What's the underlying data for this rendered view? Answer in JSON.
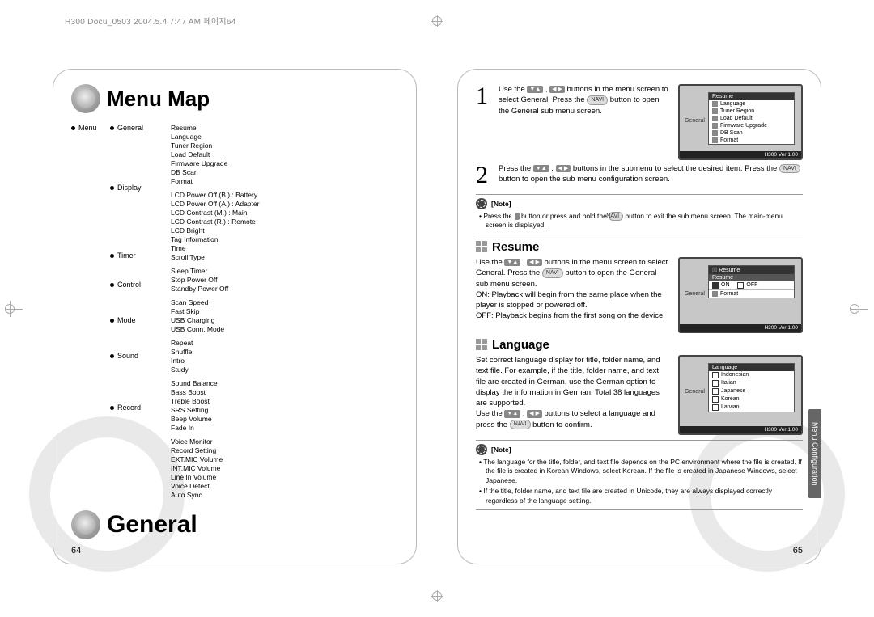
{
  "print_header": "H300 Docu_0503  2004.5.4 7:47 AM  페이지64",
  "titles": {
    "menu_map": "Menu Map",
    "general": "General"
  },
  "page_numbers": {
    "left": "64",
    "right": "65"
  },
  "menumap": {
    "root": "Menu",
    "categories": [
      {
        "name": "General",
        "items": [
          "Resume",
          "Language",
          "Tuner Region",
          "Load Default",
          "Firmware Upgrade",
          "DB Scan",
          "Format"
        ]
      },
      {
        "name": "Display",
        "items": [
          "LCD Power Off (B.) : Battery",
          "LCD Power Off (A.) : Adapter",
          "LCD Contrast (M.) : Main",
          "LCD Contrast (R.) : Remote",
          "LCD Bright",
          "Tag Information",
          "Time",
          "Scroll Type"
        ]
      },
      {
        "name": "Timer",
        "items": [
          "Sleep Timer",
          "Stop Power Off",
          "Standby Power Off"
        ]
      },
      {
        "name": "Control",
        "items": [
          "Scan Speed",
          "Fast Skip",
          "USB Charging",
          "USB Conn. Mode"
        ]
      },
      {
        "name": "Mode",
        "items": [
          "Repeat",
          "Shuffle",
          "Intro",
          "Study"
        ]
      },
      {
        "name": "Sound",
        "items": [
          "Sound Balance",
          "Bass Boost",
          "Treble Boost",
          "SRS Setting",
          "Beep Volume",
          "Fade In"
        ]
      },
      {
        "name": "Record",
        "items": [
          "Voice Monitor",
          "Record Setting",
          "EXT.MIC Volume",
          "INT.MIC Volume",
          "Line In Volume",
          "Voice Detect",
          "Auto Sync"
        ]
      }
    ]
  },
  "steps": {
    "s1_a": "Use the ",
    "s1_b": " buttons in the menu screen to select General. Press the ",
    "s1_c": " button to open the General sub menu screen.",
    "s2_a": "Press the ",
    "s2_b": " buttons in the submenu to select the desired item. Press the ",
    "s2_c": " button to open the sub menu configuration screen."
  },
  "note1": {
    "label": "[Note]",
    "body_a": "Press the ",
    "body_b": " button or press and hold the ",
    "body_c": " button to exit the sub menu screen. The main-menu screen is displayed."
  },
  "resume": {
    "title": "Resume",
    "body_a": "Use the ",
    "body_b": " buttons in the menu screen to select General. Press the ",
    "body_c": " button to open the General sub menu screen.",
    "body_d": "ON:  Playback will begin from the same place when the player is stopped or powered off.",
    "body_e": "OFF: Playback begins from the first song on the device."
  },
  "language": {
    "title": "Language",
    "body1": "Set correct language display for title, folder name, and text file. For example, if the title, folder name, and text file are created in German, use the German option to display the information in German. Total 38 languages are supported.",
    "body2_a": "Use the ",
    "body2_b": " buttons to select a language and press the ",
    "body2_c": " button to confirm."
  },
  "note2": {
    "label": "[Note]",
    "items": [
      "The language for the title, folder, and text file depends on the PC environment where the file is created. If the file is created in Korean Windows, select Korean. If the file is created in Japanese Windows, select Japanese.",
      "If the title, folder name, and text file are created in Unicode, they are always displayed correctly regardless of the language setting."
    ]
  },
  "side_tab": "Menu Configuration",
  "shot1": {
    "hdr": "Resume",
    "rows": [
      "Language",
      "Tuner Region",
      "Load Default",
      "Firmware Upgrade",
      "DB Scan",
      "Format"
    ],
    "label": "General",
    "footer": "H300 Ver 1.00"
  },
  "shot2": {
    "hdr": "Resume",
    "rowdark": "Resume",
    "on": "ON",
    "off": "OFF",
    "format": "Format",
    "label": "General",
    "footer": "H300 Ver 1.00"
  },
  "shot3": {
    "hdr": "Language",
    "rows": [
      "Indonesian",
      "Italian",
      "Japanese",
      "Korean",
      "Latvian"
    ],
    "label": "General",
    "footer": "H300 Ver 1.00"
  },
  "navi_label": "NAVI"
}
